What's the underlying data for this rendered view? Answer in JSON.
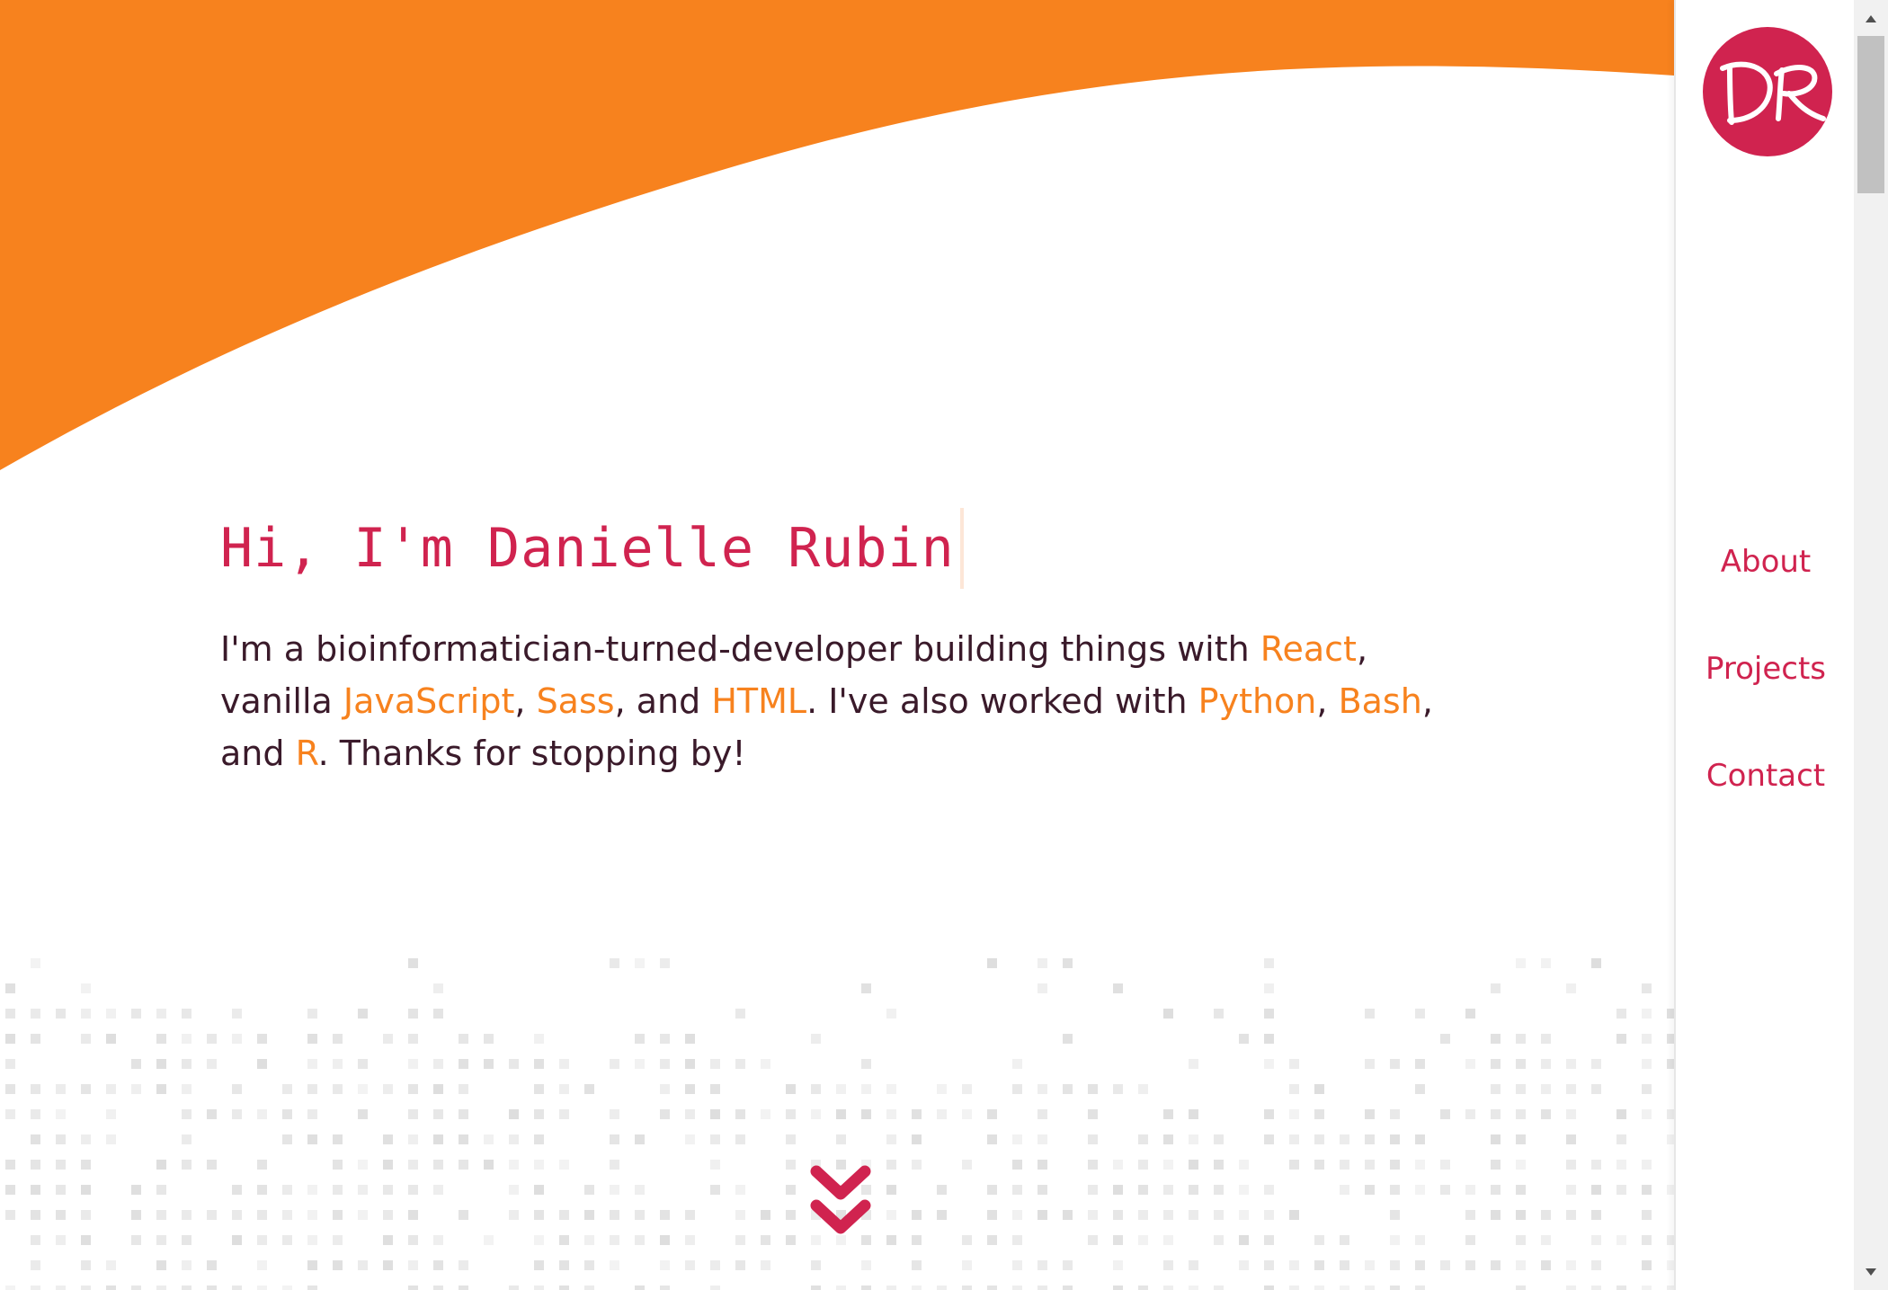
{
  "colors": {
    "accent": "#d0234f",
    "highlight": "#f7821e",
    "text": "#3a1a2a",
    "wave": "#f7821e",
    "dots": "#e6e6e6"
  },
  "hero": {
    "title": "Hi, I'm Danielle Rubin",
    "intro": {
      "t1": "I'm a bioinformatician-turned-developer building things with ",
      "react": "React",
      "t2": ", vanilla ",
      "javascript": "JavaScript",
      "t3": ", ",
      "sass": "Sass",
      "t4": ", and ",
      "html": "HTML",
      "t5": ". I've also worked with ",
      "python": "Python",
      "t6": ", ",
      "bash": "Bash",
      "t7": ", and ",
      "r": "R",
      "t8": ". Thanks for stopping by!"
    }
  },
  "sidebar": {
    "logo_text": "DR",
    "nav": [
      {
        "label": "About"
      },
      {
        "label": "Projects"
      },
      {
        "label": "Contact"
      }
    ]
  },
  "icons": {
    "scroll_down": "double-chevron-down-icon",
    "scroll_up": "triangle-up-icon",
    "scroll_down_arrow": "triangle-down-icon"
  }
}
